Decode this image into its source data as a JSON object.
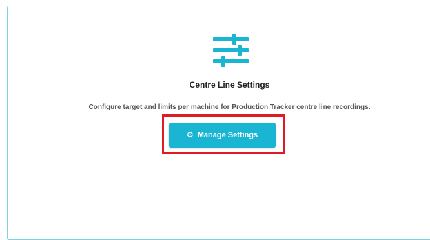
{
  "card": {
    "title": "Centre Line Settings",
    "description": "Configure target and limits per machine for Production Tracker centre line recordings.",
    "icon": "sliders-icon",
    "button": {
      "label": "Manage Settings",
      "icon": "gear-icon"
    }
  },
  "colors": {
    "accent": "#19b5d2",
    "card_border": "#7fd3e1",
    "highlight": "#e01b24"
  }
}
